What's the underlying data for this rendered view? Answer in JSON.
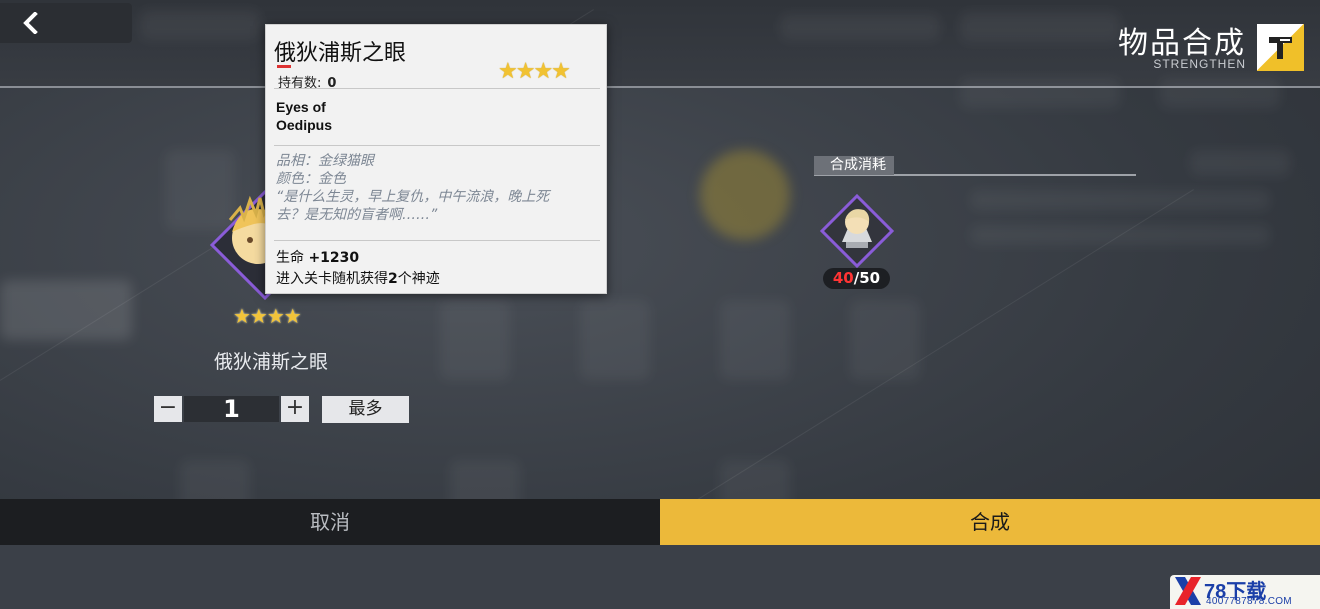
{
  "header": {
    "title": "物品合成",
    "subtitle": "STRENGTHEN"
  },
  "item": {
    "name": "俄狄浦斯之眼",
    "stars": "★★★★",
    "quantity": "1",
    "minus_label": "−",
    "plus_label": "+",
    "max_label": "最多"
  },
  "cost": {
    "label": "合成消耗",
    "have": "40",
    "need": "/50"
  },
  "tooltip": {
    "title": "俄狄浦斯之眼",
    "owned_label": "持有数:",
    "owned_value": "0",
    "stars": "★★★★",
    "english_name": "Eyes of\nOedipus",
    "quality": "品相：金绿猫眼",
    "color": "颜色：金色",
    "quote": "“是什么生灵，早上复仇，中午流浪，晚上死\n去？是无知的盲者啊……”",
    "stat_label": "生命",
    "stat_value": "+1230",
    "effect_pre": "进入关卡随机获得",
    "effect_num": "2",
    "effect_post": "个神迹"
  },
  "footer": {
    "cancel_label": "取消",
    "craft_label": "合成"
  },
  "watermark": {
    "brand": "78下载",
    "url": "4007787878.COM"
  },
  "colors": {
    "accent_yellow": "#ecb93a",
    "count_red": "#ff3434",
    "star_gold": "#f2c43a",
    "rarity_purple": "#8a5cd8"
  }
}
